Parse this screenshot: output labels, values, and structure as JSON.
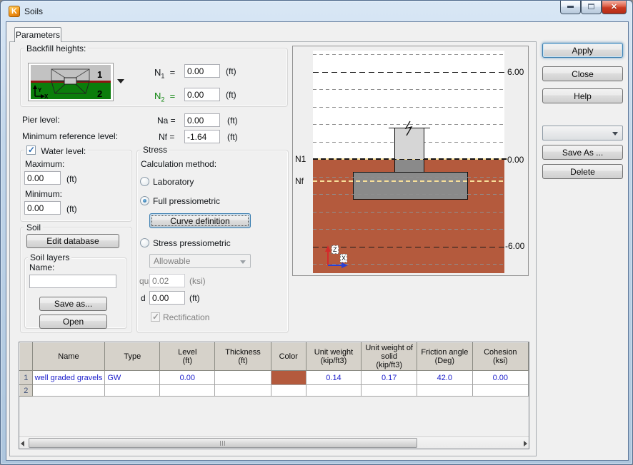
{
  "window": {
    "title": "Soils",
    "icon_letter": "K"
  },
  "tabs": {
    "parameters": "Parameters"
  },
  "backfill": {
    "caption": "Backfill heights:",
    "thumb": {
      "zone1": "1",
      "zone2": "2",
      "axis_y": "Y",
      "axis_x": "X"
    },
    "n1": {
      "base": "N",
      "sub": "1",
      "eq": "=",
      "value": "0.00",
      "unit": "(ft)"
    },
    "n2": {
      "base": "N",
      "sub": "2",
      "eq": "=",
      "value": "0.00",
      "unit": "(ft)"
    }
  },
  "levels": {
    "pier_label": "Pier level:",
    "na_label": "Na =",
    "na_value": "0.00",
    "na_unit": "(ft)",
    "minref_label": "Minimum reference level:",
    "nf_label": "Nf =",
    "nf_value": "-1.64",
    "nf_unit": "(ft)"
  },
  "water": {
    "caption": "Water level:",
    "max_label": "Maximum:",
    "max_value": "0.00",
    "max_unit": "(ft)",
    "min_label": "Minimum:",
    "min_value": "0.00",
    "min_unit": "(ft)"
  },
  "soil": {
    "caption": "Soil",
    "edit_database": "Edit database",
    "layers_caption": "Soil layers",
    "name_label": "Name:",
    "name_value": "",
    "save_as": "Save as...",
    "open": "Open"
  },
  "stress": {
    "caption": "Stress",
    "calc_label": "Calculation method:",
    "laboratory": "Laboratory",
    "full": "Full pressiometric",
    "curve_button": "Curve definition",
    "stress_pressio": "Stress pressiometric",
    "combo_value": "Allowable",
    "qu_label": "qu",
    "qu_value": "0.02",
    "qu_unit": "(ksi)",
    "d_label": "d",
    "d_value": "0.00",
    "d_unit": "(ft)",
    "rectification": "Rectification"
  },
  "diagram": {
    "n1": "N1",
    "nf": "Nf",
    "tick_top": "6.00",
    "tick_zero": "0.00",
    "tick_bottom": "-6.00",
    "axis_z": "Z",
    "axis_x": "X",
    "soil_color": "#b45a3d"
  },
  "side": {
    "apply": "Apply",
    "close": "Close",
    "help": "Help",
    "combo_value": "",
    "save_as": "Save As ...",
    "delete": "Delete"
  },
  "table": {
    "headers": [
      {
        "label": "Name",
        "unit": ""
      },
      {
        "label": "Type",
        "unit": ""
      },
      {
        "label": "Level",
        "unit": "(ft)"
      },
      {
        "label": "Thickness",
        "unit": "(ft)"
      },
      {
        "label": "Color",
        "unit": ""
      },
      {
        "label": "Unit weight",
        "unit": "(kip/ft3)"
      },
      {
        "label": "Unit weight of solid",
        "unit": "(kip/ft3)"
      },
      {
        "label": "Friction angle",
        "unit": "(Deg)"
      },
      {
        "label": "Cohesion",
        "unit": "(ksi)"
      }
    ],
    "rows": [
      {
        "num": "1",
        "name": "well graded gravels",
        "type": "GW",
        "level": "0.00",
        "thickness": "",
        "color": "#b45a3d",
        "unit_weight": "0.14",
        "unit_weight_solid": "0.17",
        "friction_angle": "42.0",
        "cohesion": "0.00"
      },
      {
        "num": "2",
        "name": "",
        "type": "",
        "level": "",
        "thickness": "",
        "color": "",
        "unit_weight": "",
        "unit_weight_solid": "",
        "friction_angle": "",
        "cohesion": ""
      }
    ]
  }
}
